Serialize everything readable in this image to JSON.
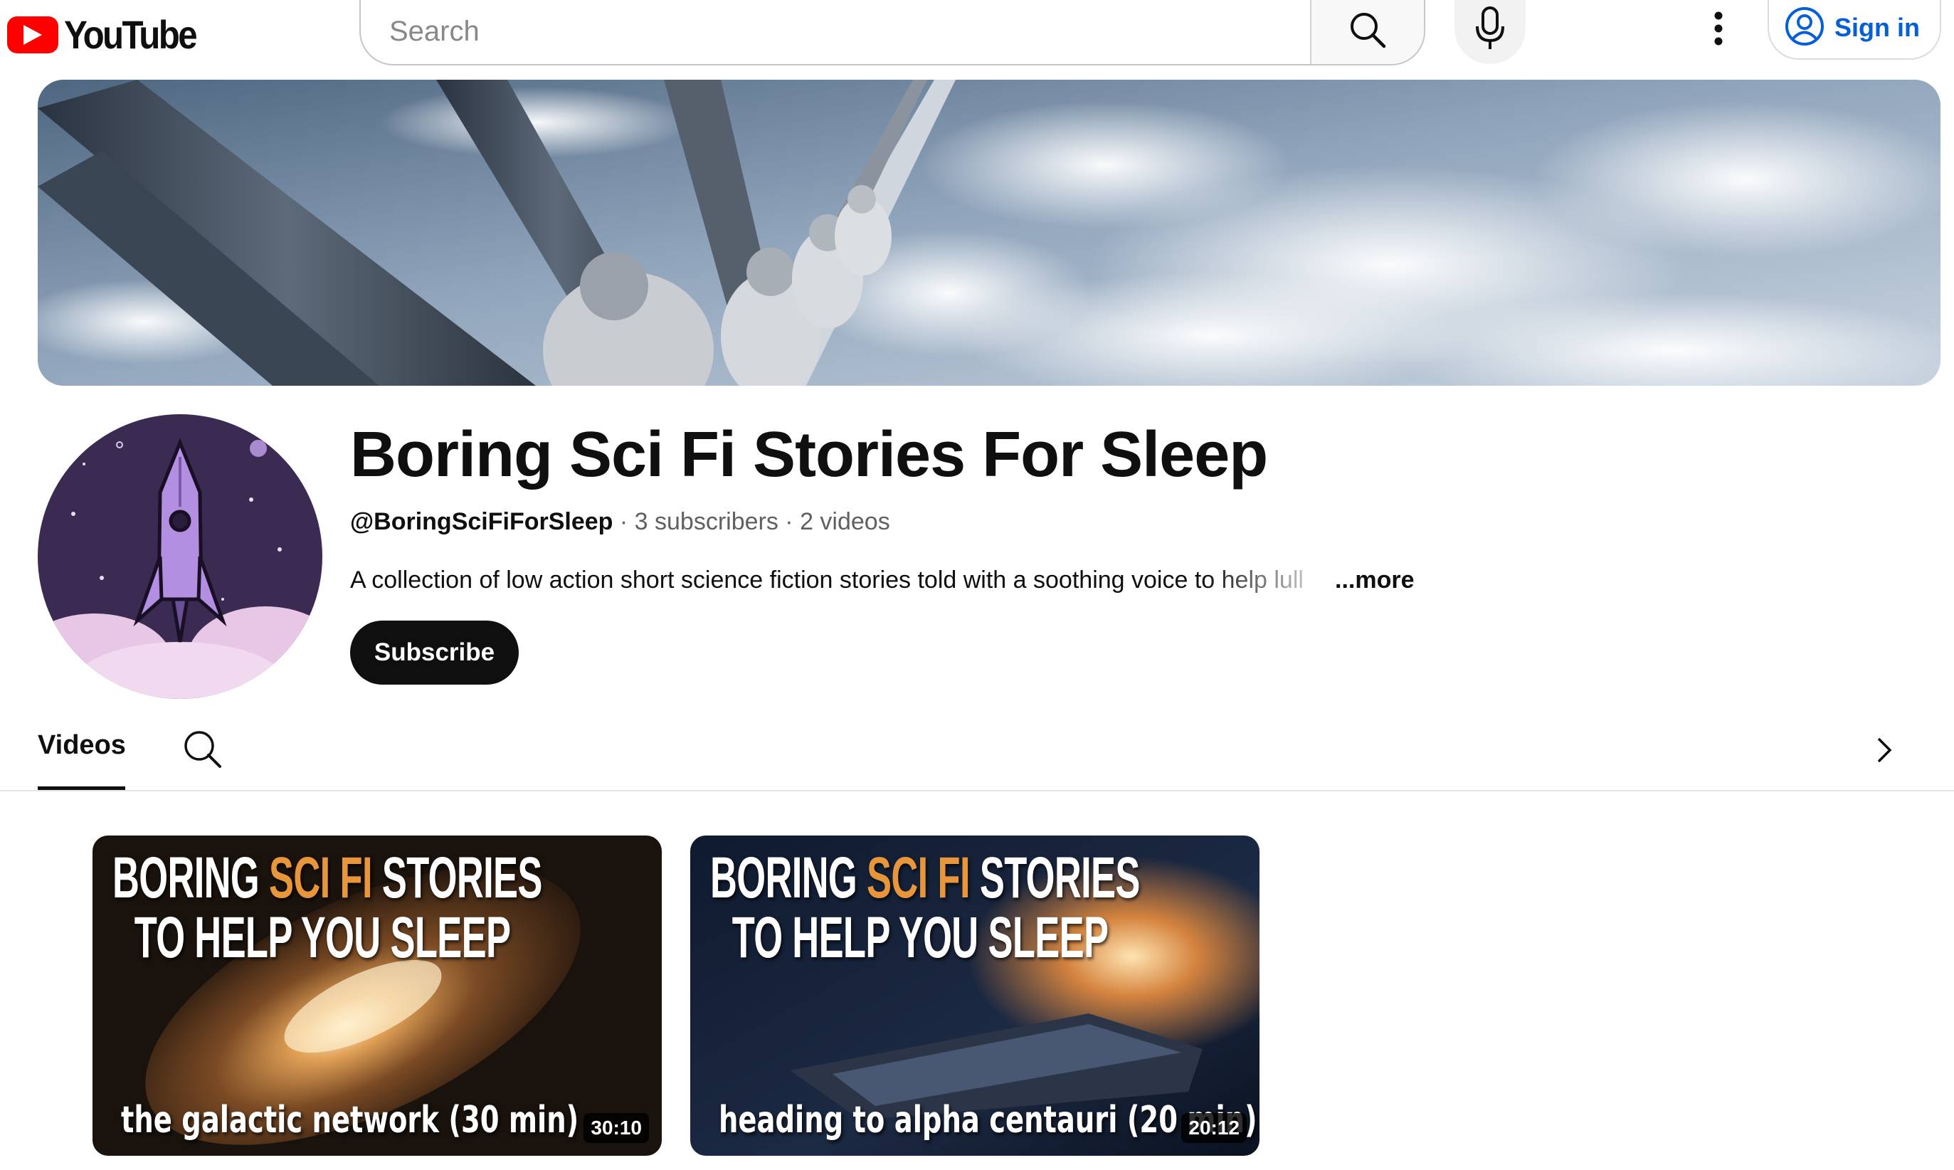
{
  "header": {
    "logo_text": "YouTube",
    "search": {
      "placeholder": "Search",
      "value": ""
    },
    "sign_in_label": "Sign in",
    "icons": [
      "youtube-logo-icon",
      "search-icon",
      "mic-icon",
      "more-vert-icon",
      "account-circle-icon"
    ]
  },
  "channel": {
    "title": "Boring Sci Fi Stories For Sleep",
    "handle": "@BoringSciFiForSleep",
    "separator": " · ",
    "subscribers": "3 subscribers",
    "videos_count": "2 videos",
    "description": "A collection of low action short science fiction stories told with a soothing voice to help lull",
    "more_label": "...more",
    "subscribe_label": "Subscribe"
  },
  "tabs": {
    "items": [
      {
        "label": "Videos",
        "selected": true
      }
    ],
    "icons": [
      "search-icon",
      "chevron-right-icon"
    ]
  },
  "videos": [
    {
      "thumb_title_a": "BORING ",
      "thumb_title_accent": "SCI FI",
      "thumb_title_b": " STORIES",
      "thumb_title_line2": "TO HELP YOU SLEEP",
      "thumb_caption": "the galactic network (30 min)",
      "duration": "30:10"
    },
    {
      "thumb_title_a": "BORING ",
      "thumb_title_accent": "SCI FI",
      "thumb_title_b": " STORIES",
      "thumb_title_line2": "TO HELP YOU SLEEP",
      "thumb_caption": "heading to alpha centauri (20 min)",
      "duration": "20:12"
    }
  ],
  "colors": {
    "brand_red": "#ff0000",
    "link_blue": "#065fd4",
    "text_primary": "#0f0f0f",
    "text_secondary": "#606060",
    "thumb_accent": "#e8963c",
    "avatar_bg": "#3b2a52",
    "avatar_cloud": "#e8c6e6"
  }
}
